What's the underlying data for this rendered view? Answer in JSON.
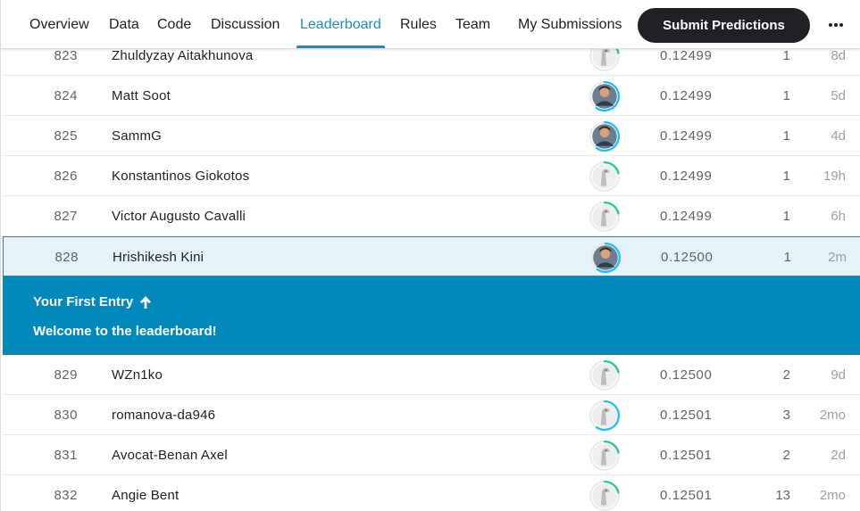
{
  "nav": {
    "tabs": [
      {
        "label": "Overview"
      },
      {
        "label": "Data"
      },
      {
        "label": "Code"
      },
      {
        "label": "Discussion"
      },
      {
        "label": "Leaderboard",
        "active": true
      },
      {
        "label": "Rules"
      },
      {
        "label": "Team"
      },
      {
        "label": "My Submissions"
      }
    ],
    "submit_label": "Submit Predictions",
    "more_icon": "more-horizontal-icon"
  },
  "colors": {
    "accent": "#1a8fbf",
    "banner": "#0089ba",
    "ring_green": "#20c997",
    "ring_blue": "#20beff"
  },
  "rows_above": [
    {
      "rank": "823",
      "name": "Zhuldyzay Aitakhunova",
      "avatar": "default-avatar-icon",
      "ring": "green",
      "score": "0.12499",
      "entries": "1",
      "last": "8d"
    },
    {
      "rank": "824",
      "name": "Matt Soot",
      "avatar": "user-photo-avatar",
      "ring": "blue",
      "score": "0.12499",
      "entries": "1",
      "last": "5d"
    },
    {
      "rank": "825",
      "name": "SammG",
      "avatar": "user-photo-avatar",
      "ring": "blue",
      "score": "0.12499",
      "entries": "1",
      "last": "4d"
    },
    {
      "rank": "826",
      "name": "Konstantinos Giokotos",
      "avatar": "default-avatar-icon",
      "ring": "green",
      "score": "0.12499",
      "entries": "1",
      "last": "19h"
    },
    {
      "rank": "827",
      "name": "Victor Augusto Cavalli",
      "avatar": "default-avatar-icon",
      "ring": "green",
      "score": "0.12499",
      "entries": "1",
      "last": "6h"
    }
  ],
  "my_row": {
    "rank": "828",
    "name": "Hrishikesh Kini",
    "avatar": "user-photo-avatar",
    "ring": "blue",
    "score": "0.12500",
    "entries": "1",
    "last": "2m"
  },
  "banner": {
    "title": "Your First Entry",
    "arrow_icon": "arrow-up-icon",
    "message": "Welcome to the leaderboard!"
  },
  "rows_below": [
    {
      "rank": "829",
      "name": "WZn1ko",
      "avatar": "default-avatar-icon",
      "ring": "green",
      "score": "0.12500",
      "entries": "2",
      "last": "9d"
    },
    {
      "rank": "830",
      "name": "romanova-da946",
      "avatar": "default-avatar-icon",
      "ring": "blue",
      "score": "0.12501",
      "entries": "3",
      "last": "2mo"
    },
    {
      "rank": "831",
      "name": "Avocat-Benan Axel",
      "avatar": "default-avatar-icon",
      "ring": "green",
      "score": "0.12501",
      "entries": "2",
      "last": "2d"
    },
    {
      "rank": "832",
      "name": "Angie Bent",
      "avatar": "default-avatar-icon",
      "ring": "green",
      "score": "0.12501",
      "entries": "13",
      "last": "2mo"
    }
  ]
}
